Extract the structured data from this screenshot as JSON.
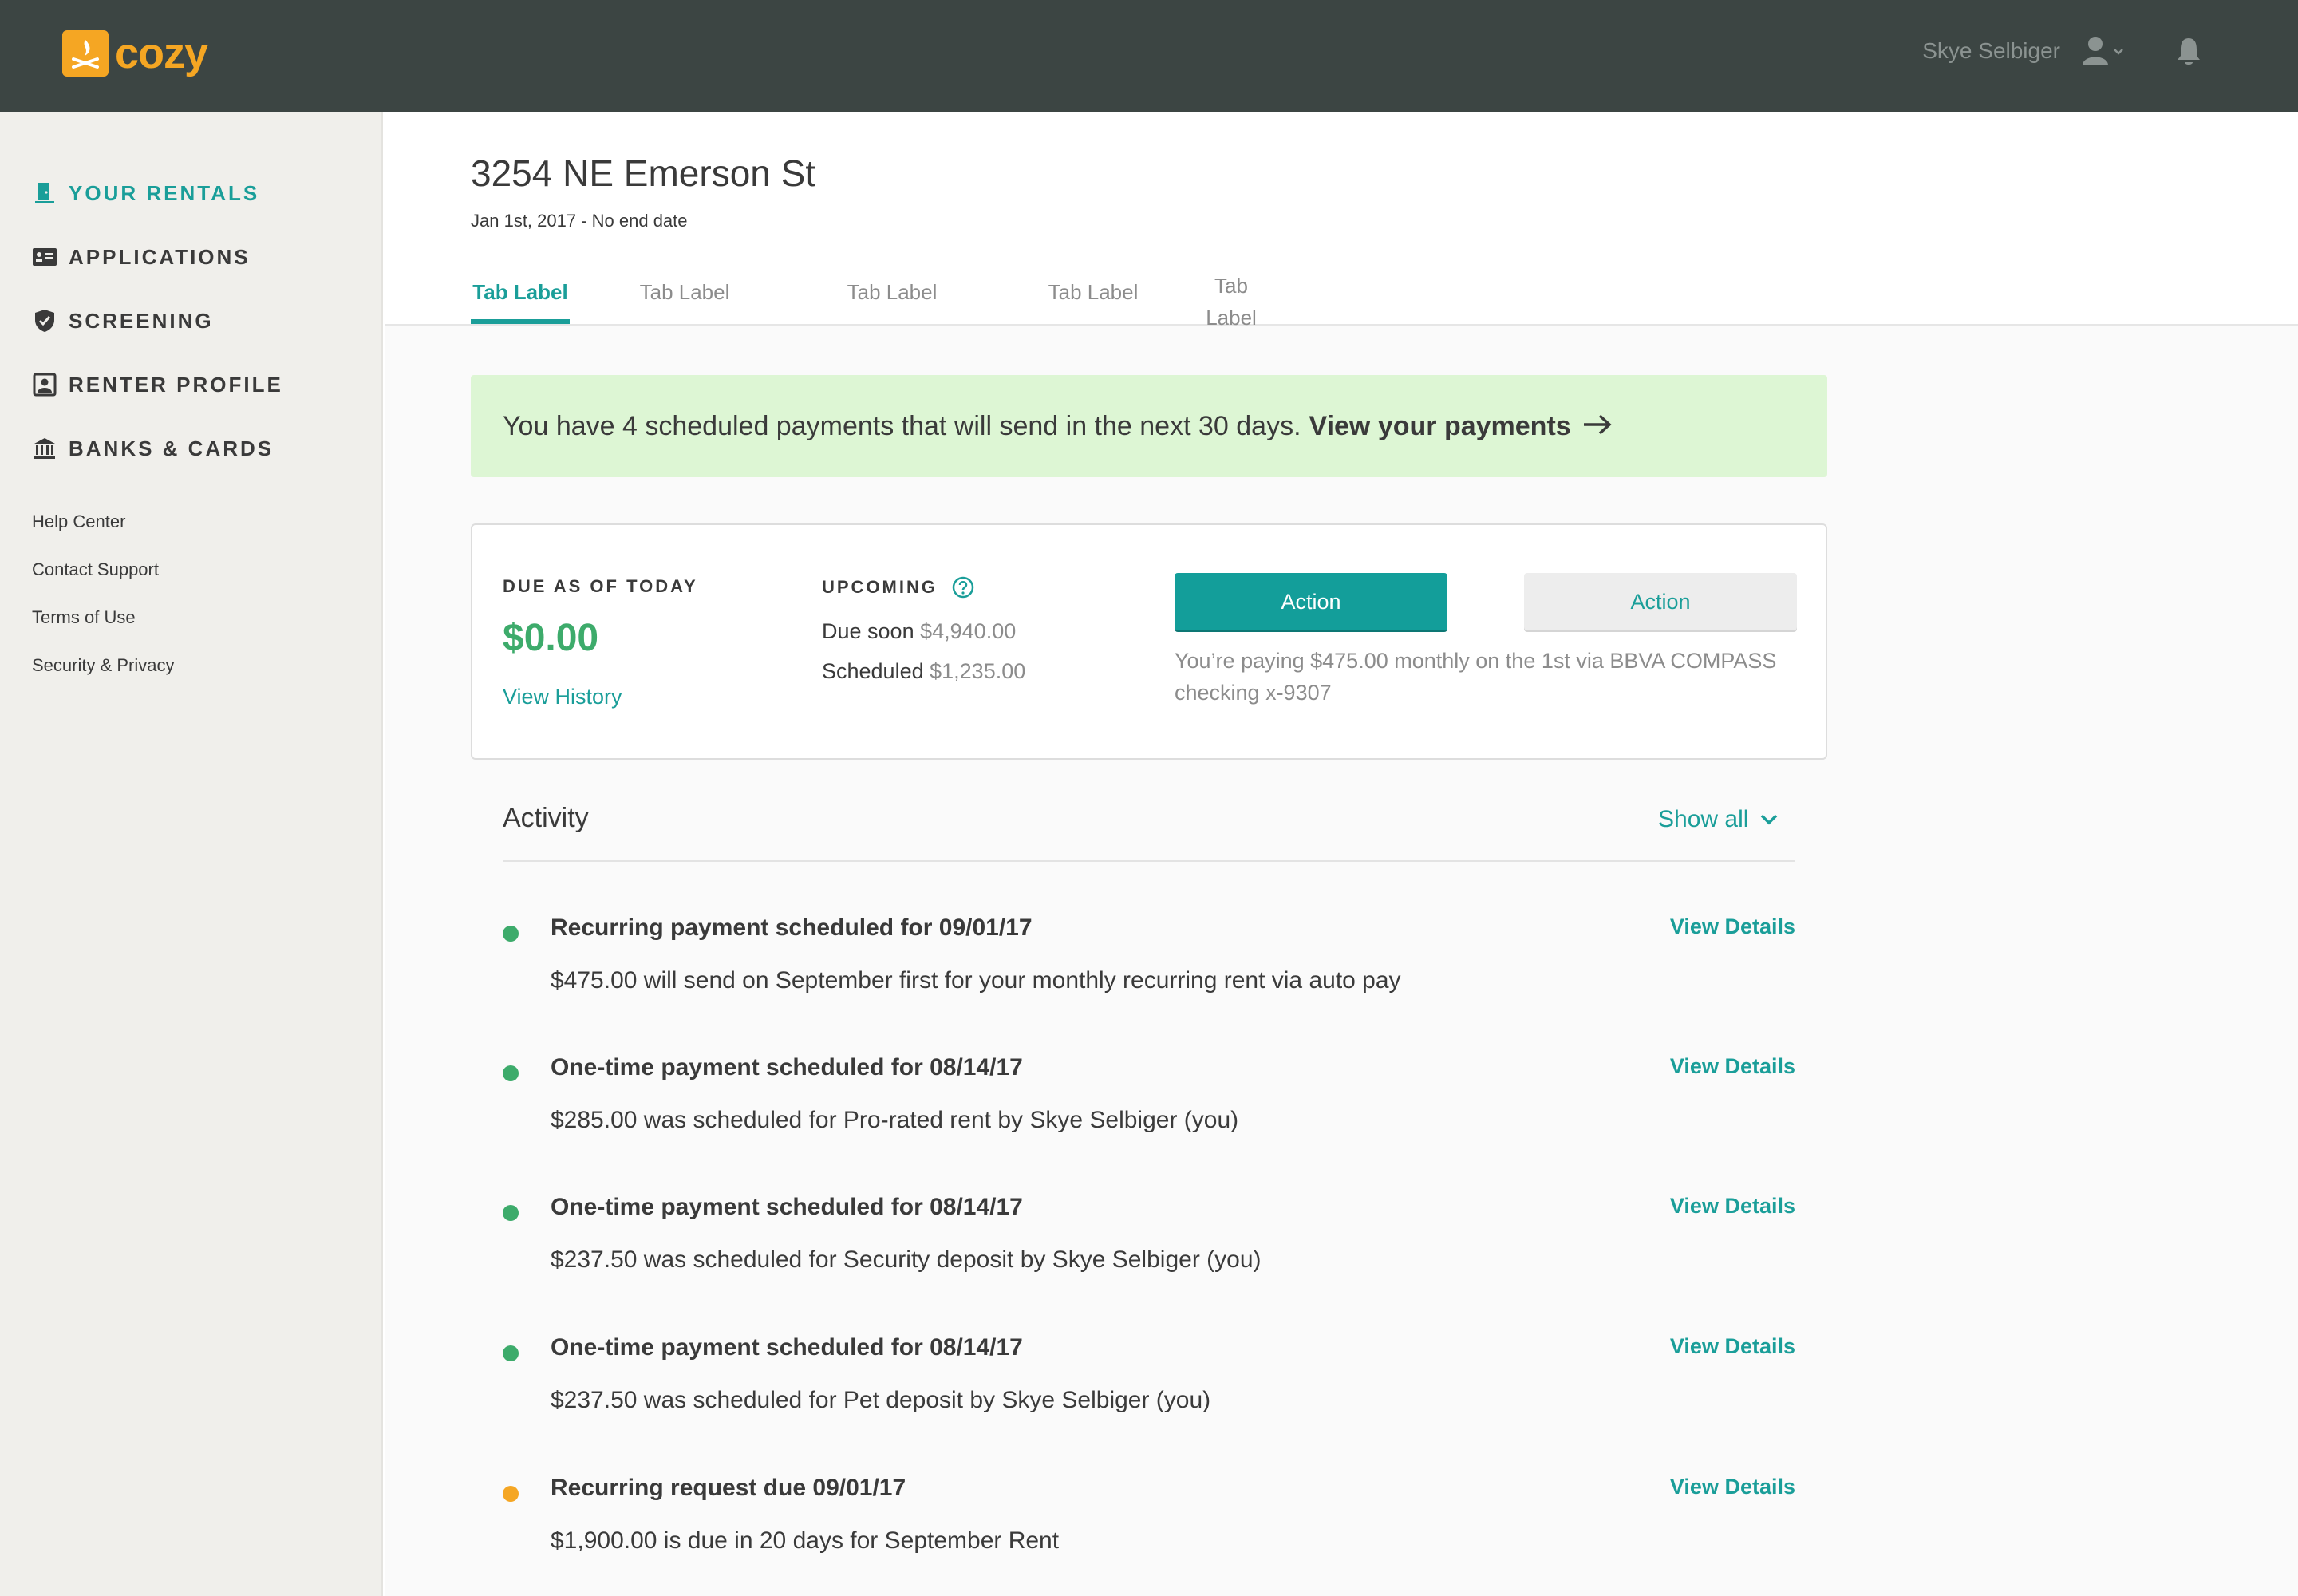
{
  "app": {
    "logo_text": "cozy",
    "user_name": "Skye Selbiger"
  },
  "sidebar": {
    "items": [
      {
        "label": "YOUR RENTALS",
        "icon": "door-icon",
        "active": true
      },
      {
        "label": "APPLICATIONS",
        "icon": "id-card-icon",
        "active": false
      },
      {
        "label": "SCREENING",
        "icon": "shield-icon",
        "active": false
      },
      {
        "label": "RENTER PROFILE",
        "icon": "profile-icon",
        "active": false
      },
      {
        "label": "BANKS & CARDS",
        "icon": "bank-icon",
        "active": false
      }
    ],
    "footer_links": [
      "Help Center",
      "Contact Support",
      "Terms of Use",
      "Security & Privacy"
    ]
  },
  "header": {
    "title": "3254 NE Emerson St",
    "subtitle": "Jan 1st, 2017 - No end date",
    "tabs": [
      "Tab Label",
      "Tab Label",
      "Tab Label",
      "Tab Label",
      "Tab Label"
    ]
  },
  "banner": {
    "text": "You have 4 scheduled payments that will send in the next 30 days.",
    "link": "View your payments"
  },
  "summary": {
    "due_label": "DUE AS OF TODAY",
    "due_amount": "$0.00",
    "view_history": "View History",
    "upcoming_label": "UPCOMING",
    "due_soon_label": "Due soon",
    "due_soon_amount": "$4,940.00",
    "scheduled_label": "Scheduled",
    "scheduled_amount": "$1,235.00",
    "primary_action": "Action",
    "secondary_action": "Action",
    "payment_note": "You’re paying $475.00 monthly on the 1st via BBVA COMPASS checking x-9307"
  },
  "activity": {
    "title": "Activity",
    "show_all": "Show all",
    "items": [
      {
        "title": "Recurring payment scheduled for 09/01/17",
        "desc": "$475.00 will send on September first for your monthly recurring rent via auto pay",
        "link": "View Details",
        "status_color": "#3dab6b"
      },
      {
        "title": "One-time payment scheduled for 08/14/17",
        "desc": "$285.00 was scheduled for Pro-rated rent by Skye Selbiger (you)",
        "link": "View Details",
        "status_color": "#3dab6b"
      },
      {
        "title": "One-time payment scheduled for 08/14/17",
        "desc": "$237.50 was scheduled for Security deposit by Skye Selbiger (you)",
        "link": "View Details",
        "status_color": "#3dab6b"
      },
      {
        "title": "One-time payment scheduled for 08/14/17",
        "desc": "$237.50 was scheduled for Pet deposit by Skye Selbiger (you)",
        "link": "View Details",
        "status_color": "#3dab6b"
      },
      {
        "title": "Recurring request due 09/01/17",
        "desc": "$1,900.00 is due in 20 days for September Rent",
        "link": "View Details",
        "status_color": "#f5a623"
      }
    ]
  },
  "colors": {
    "accent": "#1a9e99",
    "topbar": "#3c4543",
    "brand": "#f5a623",
    "success": "#3dab6b",
    "banner_bg": "#ddf6d4"
  }
}
